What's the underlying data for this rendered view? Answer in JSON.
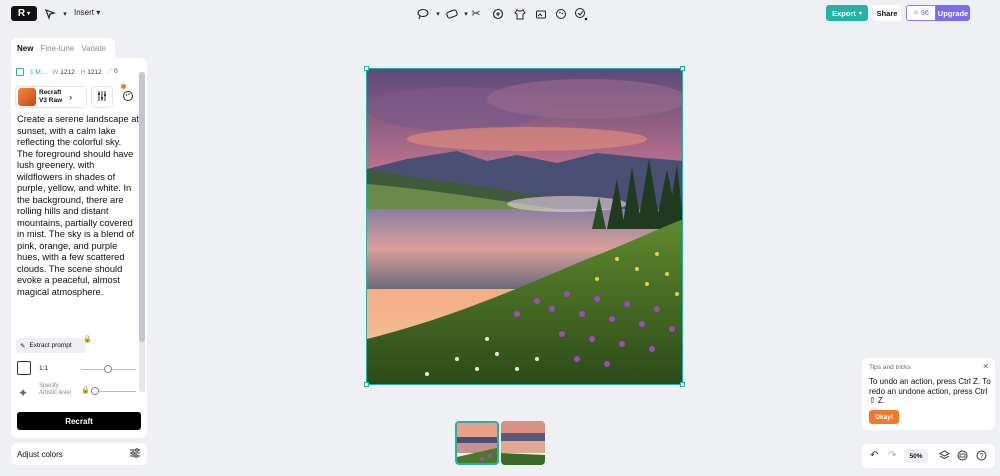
{
  "topbar": {
    "insert_label": "Insert",
    "export_label": "Export",
    "share_label": "Share",
    "credits": "96",
    "upgrade_label": "Upgrade"
  },
  "sidebar": {
    "tabs": [
      "New",
      "Fine-tune",
      "Variate"
    ],
    "meta": {
      "name": "1 M...",
      "w_label": "W",
      "w": "1212",
      "h_label": "H",
      "h": "1212",
      "seed": "0"
    },
    "model": {
      "line1": "Recraft",
      "line2": "V3 Raw"
    },
    "prompt": "Create a serene landscape at sunset, with a calm lake reflecting the colorful sky. The foreground should have lush greenery, with wildflowers in shades of purple, yellow, and white. In the background, there are rolling hills and distant mountains, partially covered in mist. The sky is a blend of pink, orange, and purple hues, with a few scattered clouds. The scene should evoke a peaceful, almost magical atmosphere.",
    "extract_label": "Extract prompt",
    "ratio_label": "1:1",
    "specify_line1": "Specify",
    "specify_line2": "Artistic level",
    "recraft_button": "Recraft",
    "adjust_colors": "Adjust colors"
  },
  "tips": {
    "title": "Tips and tricks",
    "body": "To undo an action, press Ctrl Z. To redo an undone action, press Ctrl ⇧ Z.",
    "okay_label": "Okay!"
  },
  "bottom": {
    "zoom": "50%"
  }
}
